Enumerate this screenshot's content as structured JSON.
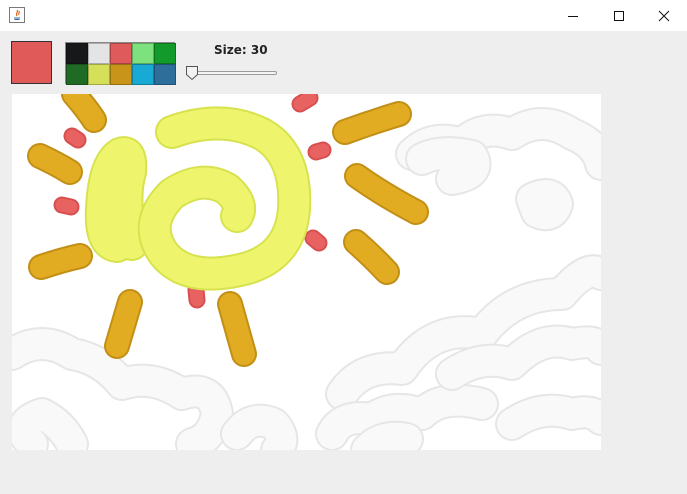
{
  "window": {
    "app_icon": "java-icon",
    "controls": [
      "minimize-icon",
      "maximize-icon",
      "close-icon"
    ]
  },
  "toolbar": {
    "current_color": "#e05a5a",
    "palette": [
      "#16181a",
      "#e4e4e4",
      "#df5a5a",
      "#7de27d",
      "#129a2a",
      "#1f6b25",
      "#d4e05a",
      "#c8941a",
      "#18aad4",
      "#2e6e9a"
    ],
    "size_label": "Size: 30",
    "size_value": 30
  },
  "canvas": {
    "sun_color": "#eef56c",
    "ray_color": "#e2ac22",
    "dot_color": "#e96262",
    "cloud_color": "#f9f9f9"
  }
}
